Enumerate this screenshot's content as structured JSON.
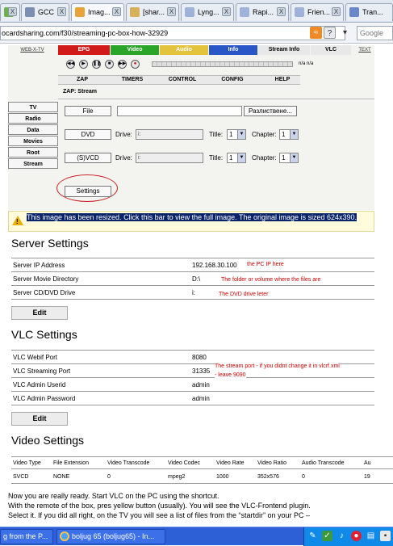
{
  "browser": {
    "tabs": [
      {
        "label": "",
        "favicon_color": "#6fb14d"
      },
      {
        "label": "GCC",
        "favicon_color": "#7b8fb2"
      },
      {
        "label": "Imag...",
        "favicon_color": "#e8a33a"
      },
      {
        "label": "[shar...",
        "favicon_color": "#d8b05a"
      },
      {
        "label": "Lyng...",
        "favicon_color": "#9fb2d9"
      },
      {
        "label": "Rapi...",
        "favicon_color": "#9fb2d9"
      },
      {
        "label": "Frien...",
        "favicon_color": "#9fb2d9"
      },
      {
        "label": "Tran...",
        "favicon_color": "#6a88c8"
      }
    ],
    "tab_close_glyph": "X",
    "url": "ocardsharing.com/f30/streaming-pc-box-how-32929",
    "search_placeholder": "Google"
  },
  "webif": {
    "brand": "WEB-X-TV",
    "mode_tabs": [
      {
        "label": "EPG",
        "color": "#d11b1b"
      },
      {
        "label": "Video",
        "color": "#2aa52a"
      },
      {
        "label": "Audio",
        "color": "#e3c23c"
      },
      {
        "label": "Info",
        "color": "#2a57c8"
      },
      {
        "label": "Stream Info",
        "color": "#e8e8e8"
      },
      {
        "label": "VLC",
        "color": "#e8e8e8"
      }
    ],
    "text_link": "TEXT",
    "transport": [
      "◀◀",
      "▶",
      "❚❚",
      "■",
      "▶▶",
      "●"
    ],
    "time_readout": "n/a n/a",
    "nav_items": [
      "ZAP",
      "TIMERS",
      "CONTROL",
      "CONFIG",
      "HELP"
    ],
    "breadcrumb": "ZAP: Stream",
    "side_menu": [
      "TV",
      "Radio",
      "Data",
      "Movies",
      "Root",
      "Stream"
    ],
    "file_button": "File",
    "browse_button": "Разлиствене...",
    "dvd_button": "DVD",
    "svcd_button": "(S)VCD",
    "drive_label": "Drive:",
    "drive_value": "i:",
    "title_label": "Title:",
    "title_value": "1",
    "chapter_label": "Chapter:",
    "chapter_value": "1",
    "settings_button": "Settings"
  },
  "resize_notice": "This image has been resized. Click this bar to view the full image. The original image is sized 624x390.",
  "server_settings": {
    "heading": "Server Settings",
    "rows": [
      {
        "label": "Server IP Address",
        "value": "192.168.30.100",
        "note": "the PC IP here"
      },
      {
        "label": "Server Movie Directory",
        "value": "D:\\",
        "note": "The folder or volume where the files are"
      },
      {
        "label": "Server CD/DVD Drive",
        "value": "i:",
        "note": "The DVD drive leter"
      }
    ],
    "edit_button": "Edit"
  },
  "vlc_settings": {
    "heading": "VLC Settings",
    "rows": [
      {
        "label": "VLC Webif Port",
        "value": "8080"
      },
      {
        "label": "VLC Streaming Port",
        "value": "31335"
      },
      {
        "label": "VLC Admin Userid",
        "value": "admin"
      },
      {
        "label": "VLC Admin Password",
        "value": "admin"
      }
    ],
    "note_line1": "The stream port - if you didnt change it in vlcrf.xml",
    "note_line2": "- leave 9090",
    "edit_button": "Edit"
  },
  "video_settings": {
    "heading": "Video Settings",
    "columns": [
      "Video Type",
      "File Extension",
      "Video Transcode",
      "Video Codec",
      "Video Rate",
      "Video Ratio",
      "Audio Transcode",
      "Au"
    ],
    "values": [
      "SVCD",
      "NONE",
      "0",
      "mpeg2",
      "1000",
      "352x576",
      "0",
      "19"
    ]
  },
  "body_text": [
    "Now you are really ready. Start VLC on the PC using the shortcut.",
    "With the remote of the box, pres yellow button (usually). You will see the VLC-Frontend plugin.",
    "Select it. If you did all right, on the TV you will see a list of files from the “startdir” on your PC –"
  ],
  "taskbar": {
    "buttons": [
      "g from the P...",
      "boljug 65 (boljug65) - In..."
    ]
  }
}
